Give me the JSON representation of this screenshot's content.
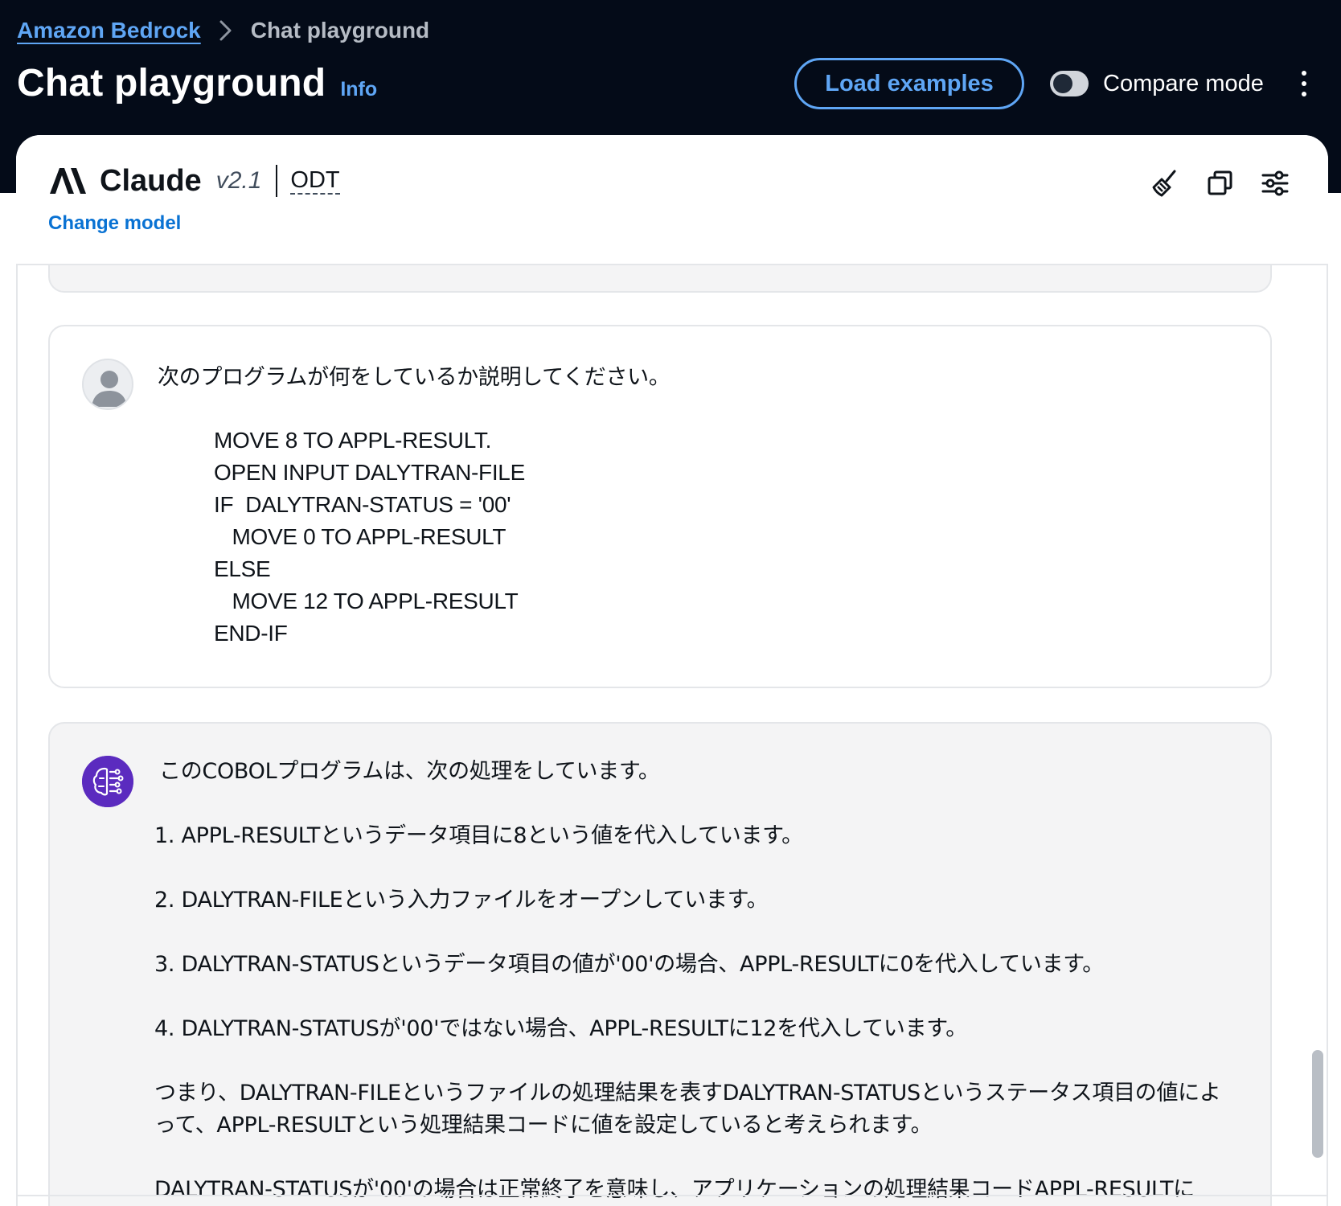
{
  "breadcrumb": {
    "root": "Amazon Bedrock",
    "current": "Chat playground"
  },
  "header": {
    "title": "Chat playground",
    "info": "Info",
    "load_examples": "Load examples",
    "compare_mode": "Compare mode",
    "compare_mode_on": false
  },
  "model": {
    "name": "Claude",
    "version": "v2.1",
    "tag": "ODT",
    "change_model": "Change model"
  },
  "icons": {
    "clear": "broom-icon",
    "copy": "copy-icon",
    "settings": "sliders-icon",
    "menu": "kebab-menu-icon",
    "user": "user-avatar-icon",
    "assistant": "brain-circuit-icon"
  },
  "colors": {
    "header_bg": "#040b18",
    "link": "#5fa6f5",
    "accent": "#0972d3",
    "assistant_avatar": "#5b2bbf"
  },
  "messages": {
    "user": {
      "intro": "次のプログラムが何をしているか説明してください。",
      "code": "MOVE 8 TO APPL-RESULT.\nOPEN INPUT DALYTRAN-FILE\nIF  DALYTRAN-STATUS = '00'\n   MOVE 0 TO APPL-RESULT\nELSE\n   MOVE 12 TO APPL-RESULT\nEND-IF"
    },
    "assistant": {
      "intro": "このCOBOLプログラムは、次の処理をしています。",
      "p1": "1. APPL-RESULTというデータ項目に8という値を代入しています。",
      "p2": "2. DALYTRAN-FILEという入力ファイルをオープンしています。",
      "p3": "3. DALYTRAN-STATUSというデータ項目の値が'00'の場合、APPL-RESULTに0を代入しています。",
      "p4": "4. DALYTRAN-STATUSが'00'ではない場合、APPL-RESULTに12を代入しています。",
      "p5": "つまり、DALYTRAN-FILEというファイルの処理結果を表すDALYTRAN-STATUSというステータス項目の値によって、APPL-RESULTという処理結果コードに値を設定していると考えられます。",
      "p6": "DALYTRAN-STATUSが'00'の場合は正常終了を意味し、アプリケーションの処理結果コードAPPL-RESULTに"
    }
  }
}
